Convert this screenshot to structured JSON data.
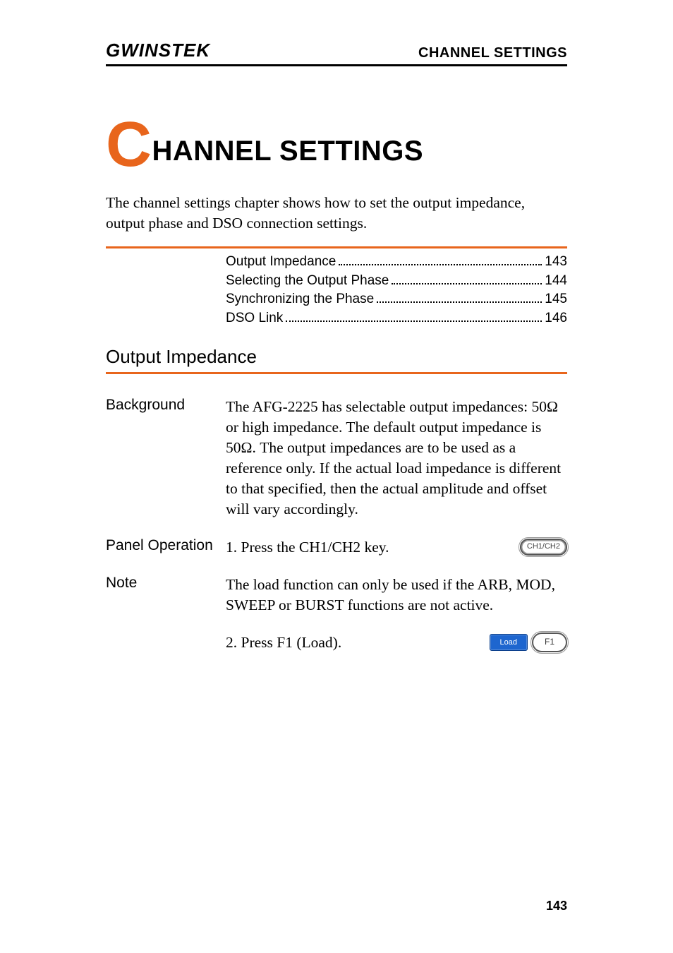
{
  "header": {
    "logo_text": "GWINSTEK",
    "title": "CHANNEL SETTINGS"
  },
  "chapter": {
    "big_letter": "C",
    "rest": "HANNEL SETTINGS"
  },
  "intro": "The channel settings chapter shows how to set the output impedance, output phase and DSO connection settings.",
  "toc": [
    {
      "label": "Output Impedance",
      "page": "143"
    },
    {
      "label": "Selecting the Output Phase",
      "page": "144"
    },
    {
      "label": "Synchronizing the Phase",
      "page": "145"
    },
    {
      "label": "DSO Link",
      "page": "146"
    }
  ],
  "section": {
    "title": "Output Impedance",
    "background_label": "Background",
    "background_body": "The AFG-2225 has selectable output impedances: 50Ω or high impedance. The default output impedance is 50Ω. The output impedances are to be used as a reference only. If the actual load impedance is different to that specified, then the actual amplitude and offset will vary accordingly.",
    "panel_label": "Panel Operation",
    "step1_text": "1.  Press the CH1/CH2 key.",
    "step1_key": "CH1/CH2",
    "note_label": "Note",
    "note_body": "The load function can only be used if the ARB, MOD, SWEEP or BURST functions are not active.",
    "step2_text": "2.  Press F1 (Load).",
    "step2_soft_label": "Load",
    "step2_fkey": "F1"
  },
  "page_number": "143"
}
